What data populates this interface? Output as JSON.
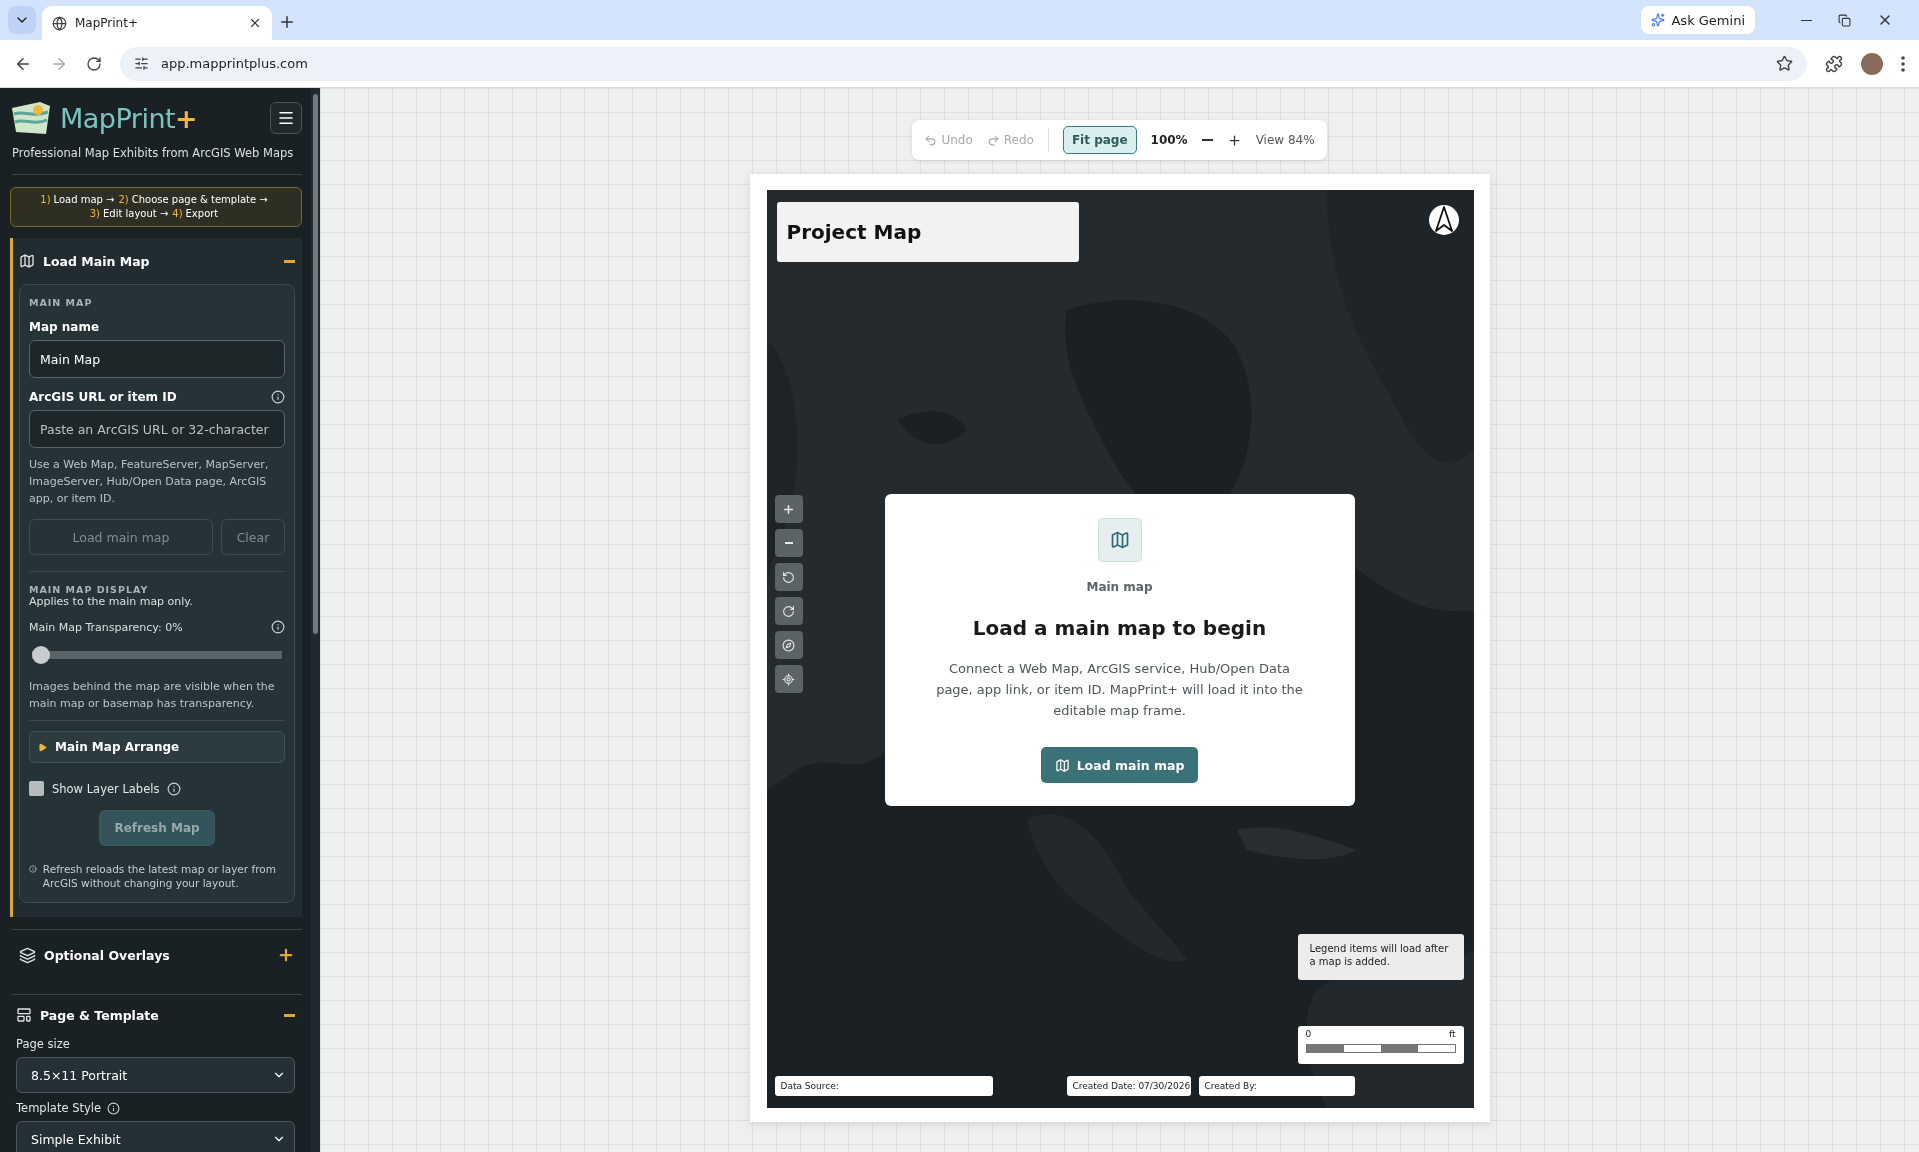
{
  "browser": {
    "tab_title": "MapPrint+",
    "url": "app.mapprintplus.com",
    "assistant_button": "Ask Gemini"
  },
  "sidebar": {
    "brand": "MapPrint",
    "brand_mark": "+",
    "tagline": "Professional Map Exhibits from ArcGIS Web Maps",
    "steps": [
      {
        "num": "1)",
        "text": "Load map →"
      },
      {
        "num": "2)",
        "text": "Choose page & template →"
      },
      {
        "num": "3)",
        "text": "Edit layout →"
      },
      {
        "num": "4)",
        "text": "Export"
      }
    ],
    "load_section": {
      "title": "Load Main Map",
      "expanded": true,
      "active": true,
      "group_label": "MAIN MAP",
      "name_label": "Map name",
      "name_value": "Main Map",
      "url_label": "ArcGIS URL or item ID",
      "url_placeholder": "Paste an ArcGIS URL or 32-character",
      "url_help": "Use a Web Map, FeatureServer, MapServer, ImageServer, Hub/Open Data page, ArcGIS app, or item ID.",
      "buttons": [
        {
          "label": "Load main map",
          "disabled": true
        },
        {
          "label": "Clear",
          "disabled": true
        }
      ],
      "display_label": "MAIN MAP DISPLAY",
      "display_note": "Applies to the main map only.",
      "transparency_label": "Main Map Transparency: 0%",
      "transparency": {
        "level": 0
      },
      "transparency_note": "Images behind the map are visible when the main map or basemap has transparency.",
      "arrange": {
        "label": "Main Map Arrange",
        "expanded": false
      },
      "layer_labels": {
        "label": "Show Layer Labels",
        "checked": false
      },
      "refresh": {
        "label": "Refresh Map",
        "disabled": true
      },
      "refresh_note": "Refresh reloads the latest map or layer from ArcGIS without changing your layout."
    },
    "overlays_section": {
      "title": "Optional Overlays",
      "expanded": false
    },
    "page_section": {
      "title": "Page & Template",
      "expanded": true,
      "page_size_label": "Page size",
      "page_size": "8.5×11 Portrait",
      "template_label": "Template Style",
      "template": "Simple Exhibit"
    }
  },
  "toolbar": {
    "undo": {
      "label": "Undo",
      "disabled": true
    },
    "redo": {
      "label": "Redo",
      "disabled": true
    },
    "fit": {
      "label": "Fit page",
      "selected": true
    },
    "zoom": "100%",
    "view": "View 84%"
  },
  "page": {
    "title": "Project Map",
    "empty_state": {
      "caption": "Main map",
      "heading": "Load a main map to begin",
      "body": "Connect a Web Map, ArcGIS service, Hub/Open Data page, app link, or item ID. MapPrint+ will load it into the editable map frame.",
      "button": "Load main map"
    },
    "legend_note": "Legend items will load after a map is added.",
    "scale": {
      "start": "0",
      "unit": "ft"
    },
    "footer": {
      "source": "Data Source:",
      "date": "Created Date: 07/30/2026",
      "author": "Created By:"
    }
  }
}
